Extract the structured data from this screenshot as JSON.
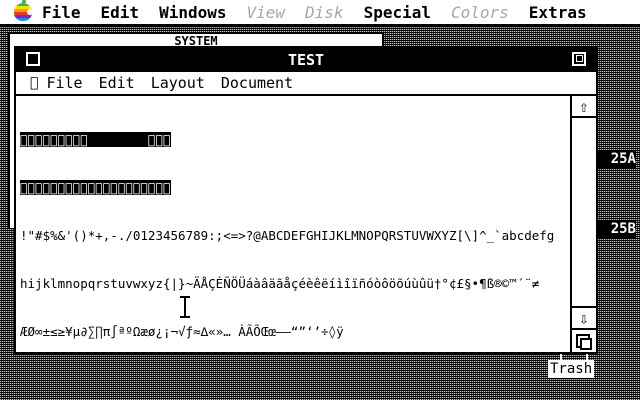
{
  "menubar": {
    "items": [
      "File",
      "Edit",
      "Windows",
      "View",
      "Disk",
      "Special",
      "Colors",
      "Extras"
    ]
  },
  "background_window": {
    "title": "SYSTEM"
  },
  "desktop": {
    "right_labels": [
      "25A",
      "25B"
    ],
    "trash_label": "Trash"
  },
  "window": {
    "title": "TEST",
    "menu": [
      "File",
      "Edit",
      "Layout",
      "Document"
    ],
    "lines": [
      "\u0000\u0000\u0000\u0000\u0000\u0000\u0000\u0000\u0000        \u0000\u0000\u0000",
      "\u0000\u0000\u0000\u0000\u0000\u0000\u0000\u0000\u0000\u0000\u0000\u0000\u0000\u0000\u0000\u0000\u0000\u0000\u0000\u0000",
      "!\"#$%&'()*+,-./0123456789:;<=>?@ABCDEFGHIJKLMNOPQRSTUVWXYZ[\\]^_`abcdefg",
      "hijklmnopqrstuvwxyz{|}~ÄÅÇÉÑÖÜáàâäãåçéèêëíìîïñóòôöõúùûü†°¢£§•¶ß®©™´¨≠",
      "ÆØ∞±≤≥¥µ∂∑∏π∫ªºΩæø¿¡¬√ƒ≈∆«»… ÀÃÕŒœ–—“”‘’÷◊ÿ",
      "\u0000\u0000\u0000\u0000\u0000\u0000\u0000\u0000\u0000\u0000"
    ]
  }
}
